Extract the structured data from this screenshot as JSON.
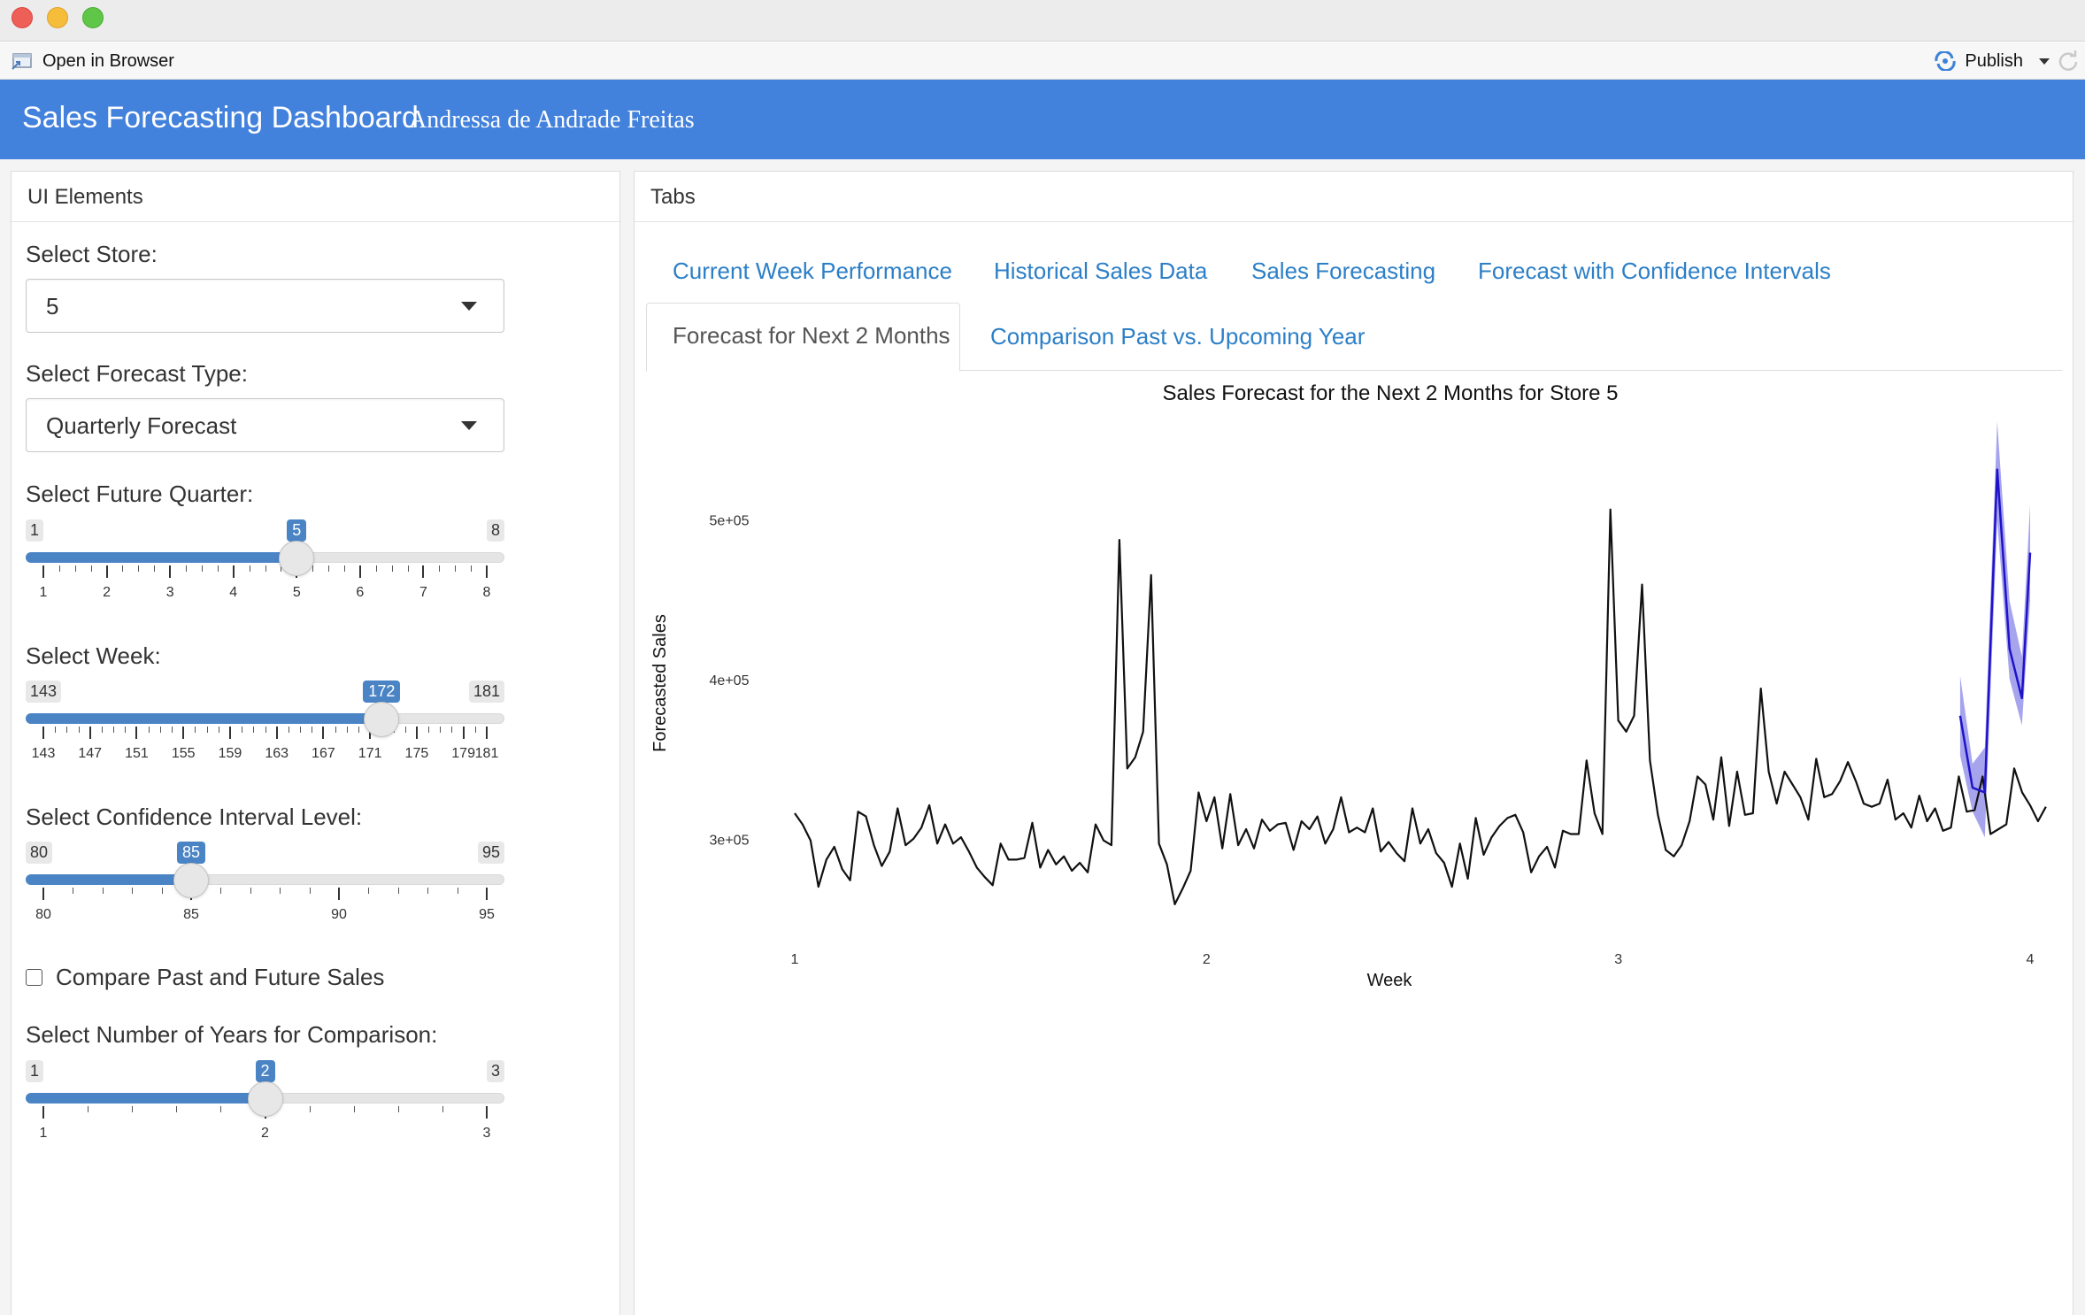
{
  "window": {
    "toolbar": {
      "open_in_browser": "Open in Browser",
      "publish": "Publish"
    }
  },
  "header": {
    "title": "Sales Forecasting Dashboard",
    "author": "Andressa de Andrade Freitas",
    "color": "#4281dc"
  },
  "sidebar": {
    "title": "UI Elements",
    "store": {
      "label": "Select Store:",
      "value": "5"
    },
    "forecast_type": {
      "label": "Select Forecast Type:",
      "value": "Quarterly Forecast"
    },
    "future_quarter": {
      "label": "Select Future Quarter:",
      "min": "1",
      "max": "8",
      "value": "5",
      "ticks": [
        "1",
        "2",
        "3",
        "4",
        "5",
        "6",
        "7",
        "8"
      ]
    },
    "week": {
      "label": "Select Week:",
      "min": "143",
      "max": "181",
      "value": "172",
      "ticks": [
        "143",
        "147",
        "151",
        "155",
        "159",
        "163",
        "167",
        "171",
        "175",
        "179",
        "181"
      ]
    },
    "confidence": {
      "label": "Select Confidence Interval Level:",
      "min": "80",
      "max": "95",
      "value": "85",
      "ticks": [
        "80",
        "85",
        "90",
        "95"
      ]
    },
    "compare_checkbox": {
      "label": "Compare Past and Future Sales",
      "checked": false
    },
    "years": {
      "label": "Select Number of Years for Comparison:",
      "min": "1",
      "max": "3",
      "value": "2",
      "ticks": [
        "1",
        "2",
        "3"
      ]
    },
    "accent": "#4a84c5"
  },
  "main": {
    "title": "Tabs",
    "tabs_row1": [
      "Current Week Performance",
      "Historical Sales Data",
      "Sales Forecasting",
      "Forecast with Confidence Intervals"
    ],
    "tabs_row2": [
      "Forecast for Next 2 Months",
      "Comparison Past vs. Upcoming Year"
    ],
    "active_tab": "Forecast for Next 2 Months",
    "link_color": "#2c7fc7"
  },
  "chart_data": {
    "type": "line",
    "title": "Sales Forecast for the Next 2 Months for Store 5",
    "xlabel": "Week",
    "ylabel": "Forecasted Sales",
    "x_ticks": [
      "1",
      "2",
      "3",
      "4"
    ],
    "y_ticks": [
      "3e+05",
      "4e+05",
      "5e+05"
    ],
    "xlim": [
      1,
      4
    ],
    "ylim": [
      250000,
      560000
    ],
    "grid": false,
    "history_start": 1,
    "history_step": 0.01923,
    "history": [
      317000,
      310000,
      300000,
      271000,
      288000,
      296000,
      282000,
      275000,
      318000,
      315000,
      297000,
      284000,
      293000,
      320000,
      297000,
      301000,
      308000,
      322000,
      298000,
      310000,
      298000,
      302000,
      293000,
      283000,
      277000,
      272000,
      298000,
      288000,
      288000,
      289000,
      311000,
      283000,
      294000,
      285000,
      290000,
      281000,
      286000,
      280000,
      310000,
      300000,
      297000,
      488000,
      345000,
      352000,
      368000,
      466000,
      298000,
      285000,
      260000,
      270000,
      281000,
      330000,
      312000,
      327000,
      295000,
      329000,
      297000,
      307000,
      295000,
      313000,
      306000,
      310000,
      311000,
      294000,
      312000,
      307000,
      315000,
      298000,
      307000,
      327000,
      305000,
      308000,
      305000,
      320000,
      293000,
      299000,
      292000,
      287000,
      320000,
      298000,
      307000,
      292000,
      286000,
      271000,
      298000,
      276000,
      314000,
      291000,
      302000,
      309000,
      314000,
      316000,
      305000,
      280000,
      290000,
      296000,
      283000,
      306000,
      304000,
      304000,
      350000,
      317000,
      304000,
      507000,
      375000,
      368000,
      378000,
      460000,
      350000,
      316000,
      294000,
      290000,
      297000,
      312000,
      340000,
      335000,
      313000,
      352000,
      309000,
      343000,
      316000,
      317000,
      395000,
      343000,
      323000,
      343000,
      335000,
      327000,
      313000,
      351000,
      327000,
      329000,
      337000,
      349000,
      337000,
      323000,
      321000,
      323000,
      338000,
      313000,
      317000,
      308000,
      328000,
      312000,
      320000,
      306000,
      308000,
      340000,
      318000,
      319000,
      340000,
      304000,
      307000,
      310000,
      345000,
      330000,
      322000,
      312000,
      321000
    ],
    "forecast_x": [
      3.83,
      3.86,
      3.89,
      3.92,
      3.95,
      3.98,
      4.0
    ],
    "forecast": [
      378000,
      333000,
      330000,
      532000,
      420000,
      389000,
      480000
    ],
    "forecast_lower": [
      353000,
      318000,
      302000,
      500000,
      401000,
      372000,
      450000
    ],
    "forecast_upper": [
      403000,
      348000,
      358000,
      562000,
      450000,
      415000,
      510000
    ],
    "colors": {
      "line": "#111111",
      "forecast": "#1f13c9",
      "band": "#8a86e8"
    }
  }
}
